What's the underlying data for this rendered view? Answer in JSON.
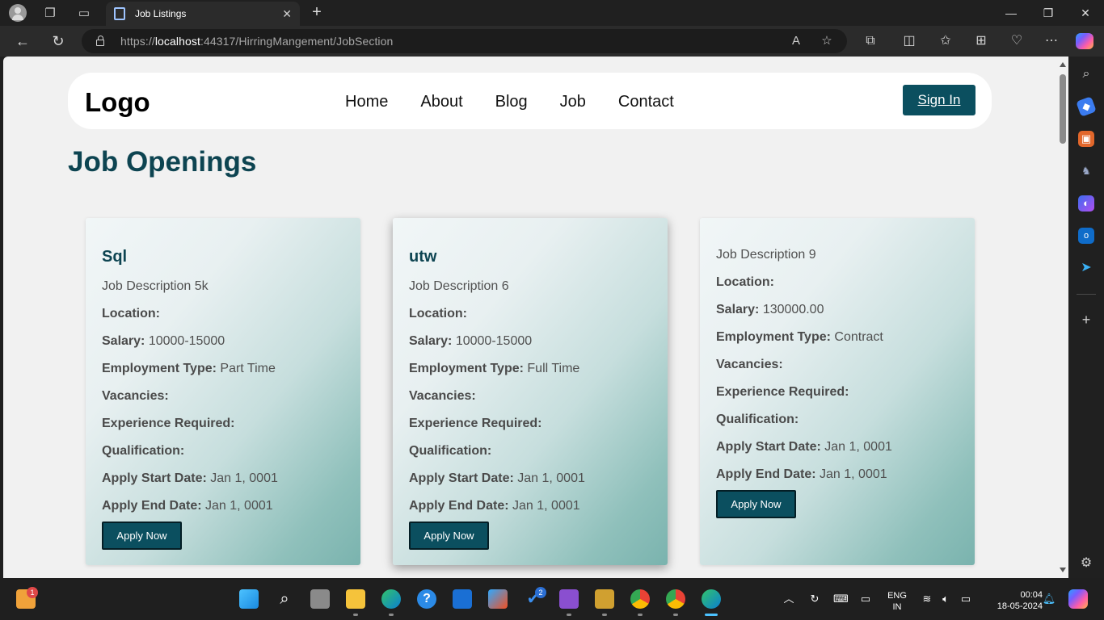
{
  "browser": {
    "tab_title": "Job Listings",
    "tab_close": "✕",
    "new_tab": "+",
    "url_scheme": "https://",
    "url_host": "localhost",
    "url_rest": ":44317/HirringMangement/JobSection"
  },
  "site": {
    "logo": "Logo",
    "nav": [
      "Home",
      "About",
      "Blog",
      "Job",
      "Contact"
    ],
    "signin": "Sign In",
    "heading": "Job Openings"
  },
  "labels": {
    "location": "Location:",
    "salary": "Salary:",
    "employment_type": "Employment Type:",
    "vacancies": "Vacancies:",
    "experience": "Experience Required:",
    "qualification": "Qualification:",
    "apply_start": "Apply Start Date:",
    "apply_end": "Apply End Date:",
    "apply_button": "Apply Now"
  },
  "jobs": [
    {
      "title": "Sql",
      "description": "Job Description 5k",
      "location": "",
      "salary": "10000-15000",
      "employment_type": "Part Time",
      "vacancies": "",
      "experience": "",
      "qualification": "",
      "apply_start": "Jan 1, 0001",
      "apply_end": "Jan 1, 0001"
    },
    {
      "title": "utw",
      "description": "Job Description 6",
      "location": "",
      "salary": "10000-15000",
      "employment_type": "Full Time",
      "vacancies": "",
      "experience": "",
      "qualification": "",
      "apply_start": "Jan 1, 0001",
      "apply_end": "Jan 1, 0001"
    },
    {
      "title": "",
      "description": "Job Description 9",
      "location": "",
      "salary": "130000.00",
      "employment_type": "Contract",
      "vacancies": "",
      "experience": "",
      "qualification": "",
      "apply_start": "Jan 1, 0001",
      "apply_end": "Jan 1, 0001"
    }
  ],
  "taskbar": {
    "notification_count": "1",
    "todo_badge": "2",
    "lang_line1": "ENG",
    "lang_line2": "IN",
    "time": "00:04",
    "date": "18-05-2024"
  },
  "colors": {
    "accent": "#0b4f5f",
    "heading": "#0d4451",
    "page_bg": "#f1f1f1"
  }
}
